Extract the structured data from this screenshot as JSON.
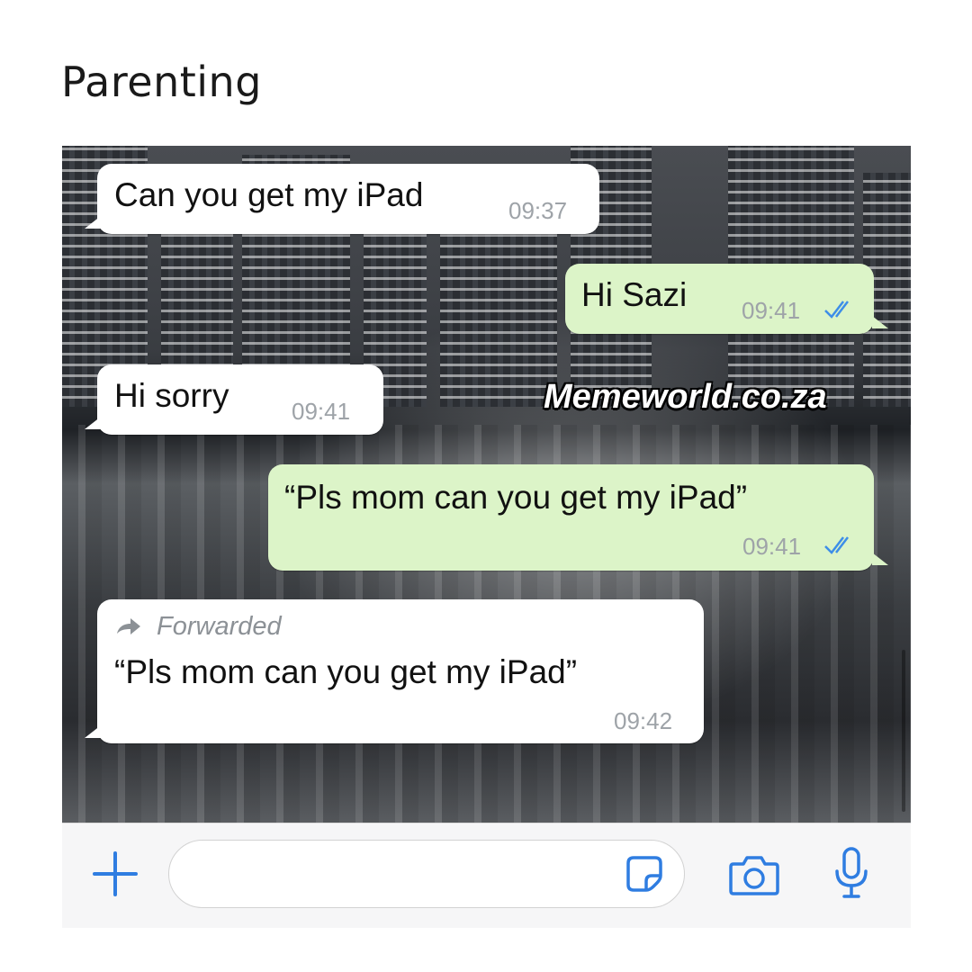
{
  "caption": "Parenting",
  "watermark": "Memeworld.co.za",
  "messages": [
    {
      "direction": "incoming",
      "text": "Can you get my iPad",
      "time": "09:37"
    },
    {
      "direction": "outgoing",
      "text": "Hi Sazi",
      "time": "09:41",
      "status": "read"
    },
    {
      "direction": "incoming",
      "text": "Hi sorry",
      "time": "09:41"
    },
    {
      "direction": "outgoing",
      "text": "“Pls mom can you get my iPad”",
      "time": "09:41",
      "status": "read"
    },
    {
      "direction": "incoming",
      "forwarded_label": "Forwarded",
      "text": "“Pls mom can you get my iPad”",
      "time": "09:42"
    }
  ],
  "toolbar": {
    "icons": [
      "plus-icon",
      "sticker-icon",
      "camera-icon",
      "microphone-icon"
    ]
  },
  "colors": {
    "accent": "#2f7de1",
    "outgoing_bubble": "#dcf4c8",
    "incoming_bubble": "#ffffff",
    "read_ticks": "#3d8ee8"
  }
}
